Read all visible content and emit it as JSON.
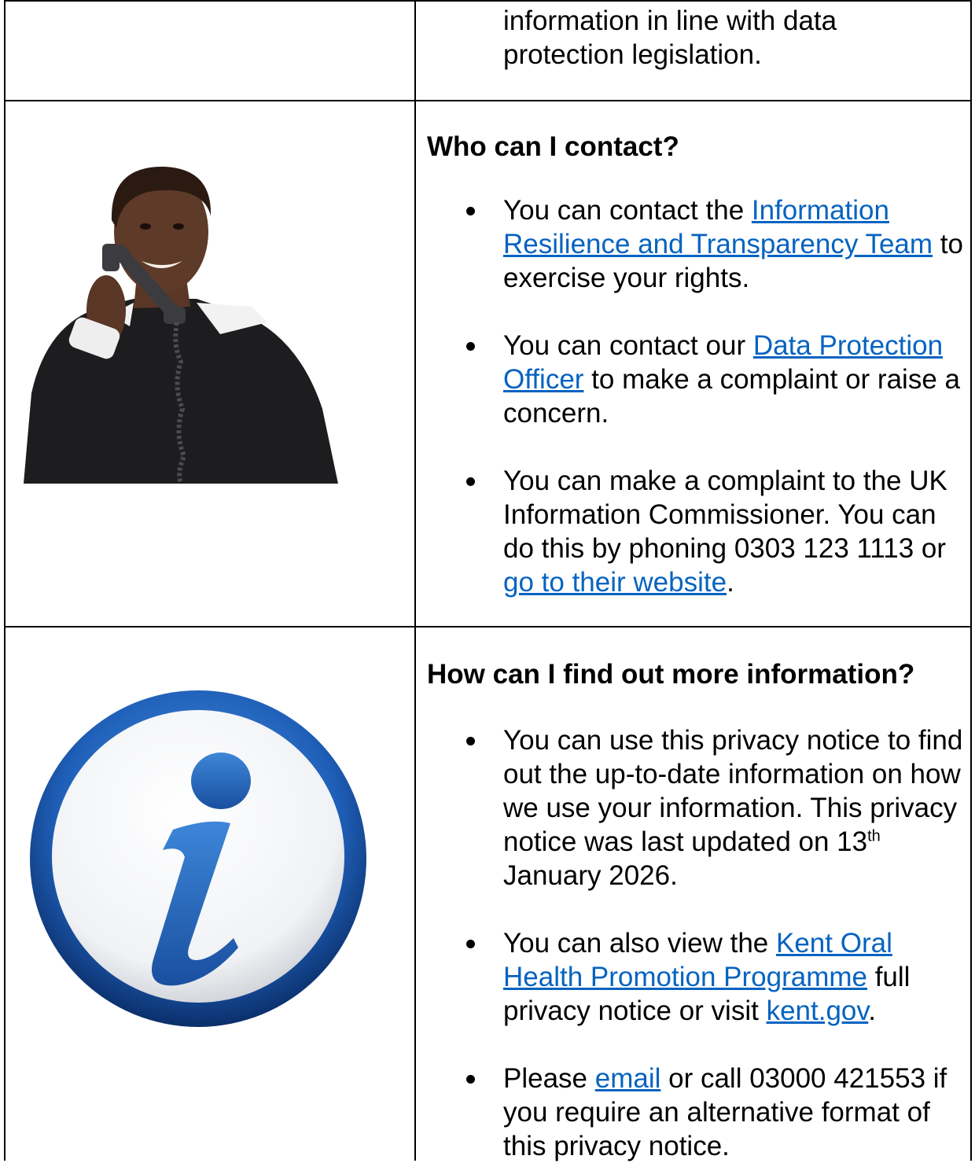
{
  "row1": {
    "continued_text": [
      "information in line with data",
      "protection legislation."
    ]
  },
  "contact": {
    "heading": "Who can I contact?",
    "illustration": "woman-on-telephone",
    "items": [
      {
        "pre": "You can contact the ",
        "link": "Information Resilience and Transparency Team",
        "post": " to exercise your rights."
      },
      {
        "pre": "You can contact our ",
        "link": "Data Protection Officer",
        "post": " to make a complaint or raise a concern."
      },
      {
        "pre": "You can make a complaint to the UK Information Commissioner. You can do this by phoning 0303 123 1113 or ",
        "link": "go to their website",
        "post": "."
      }
    ]
  },
  "more_info": {
    "heading": "How can I find out more information?",
    "illustration": "information-icon",
    "items": [
      {
        "text_before_sup": "You can use this privacy notice to find out the up-to-date information on how we use your information. This privacy notice was last updated on 13",
        "sup": "th",
        "text_after_sup": " January 2026."
      },
      {
        "pre": "You can also view the ",
        "link": "Kent Oral Health Promotion Programme",
        "mid": " full privacy notice or visit ",
        "link2": "kent.gov",
        "post": "."
      },
      {
        "pre": "Please ",
        "link": "email",
        "post": " or call 03000 421553 if you require an alternative format of this privacy notice."
      }
    ]
  },
  "colors": {
    "link": "#0563c1",
    "icon_blue": "#1f5fb8",
    "border": "#000000"
  }
}
